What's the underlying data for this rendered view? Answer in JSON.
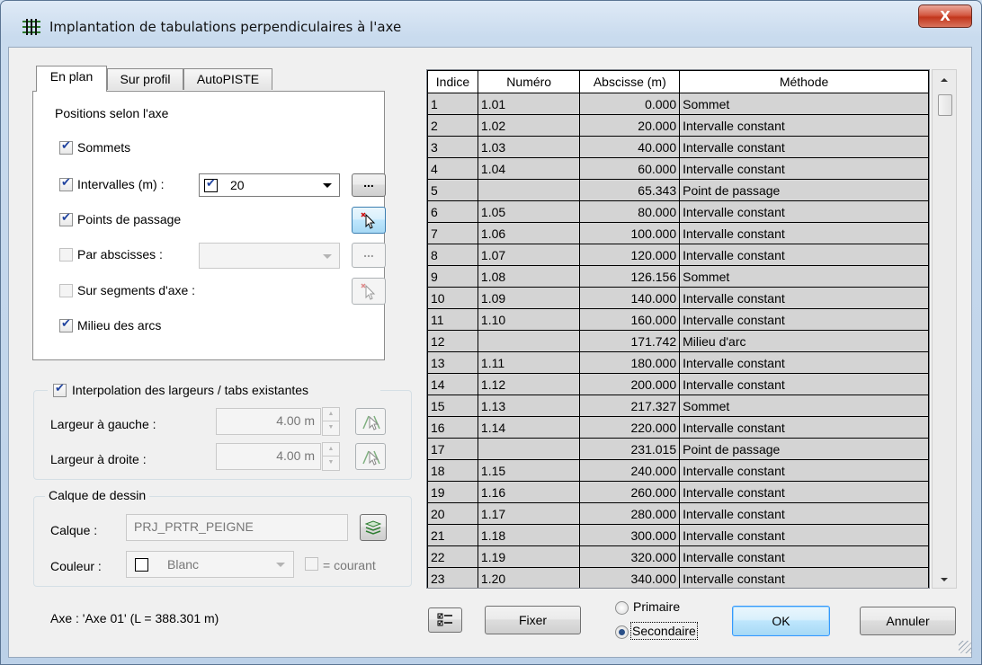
{
  "window": {
    "title": "Implantation de tabulations perpendiculaires à l'axe",
    "close_glyph": "X"
  },
  "tabs": [
    {
      "label": "En plan",
      "selected": true
    },
    {
      "label": "Sur profil",
      "selected": false
    },
    {
      "label": "AutoPISTE",
      "selected": false
    }
  ],
  "plan": {
    "group_title": "Positions selon l'axe",
    "sommets_label": "Sommets",
    "intervalles_label": "Intervalles (m) :",
    "intervalles_value": "20",
    "points_passage_label": "Points de passage",
    "par_abscisses_label": "Par abscisses :",
    "segments_label": "Sur segments d'axe :",
    "milieu_arcs_label": "Milieu des arcs",
    "ellipsis": "..."
  },
  "interpolation": {
    "label": "Interpolation des largeurs / tabs existantes",
    "gauche_label": "Largeur à gauche :",
    "gauche_value": "4.00 m",
    "droite_label": "Largeur à droite :",
    "droite_value": "4.00 m"
  },
  "calque": {
    "group_title": "Calque de dessin",
    "calque_label": "Calque :",
    "calque_value": "PRJ_PRTR_PEIGNE",
    "couleur_label": "Couleur :",
    "couleur_value": "Blanc",
    "courant_label": "= courant"
  },
  "axe_info": "Axe : 'Axe 01' (L = 388.301 m)",
  "table": {
    "headers": [
      "Indice",
      "Numéro",
      "Abscisse (m)",
      "Méthode"
    ],
    "rows": [
      [
        "1",
        "1.01",
        "0.000",
        "Sommet"
      ],
      [
        "2",
        "1.02",
        "20.000",
        "Intervalle constant"
      ],
      [
        "3",
        "1.03",
        "40.000",
        "Intervalle constant"
      ],
      [
        "4",
        "1.04",
        "60.000",
        "Intervalle constant"
      ],
      [
        "5",
        "",
        "65.343",
        "Point de passage"
      ],
      [
        "6",
        "1.05",
        "80.000",
        "Intervalle constant"
      ],
      [
        "7",
        "1.06",
        "100.000",
        "Intervalle constant"
      ],
      [
        "8",
        "1.07",
        "120.000",
        "Intervalle constant"
      ],
      [
        "9",
        "1.08",
        "126.156",
        "Sommet"
      ],
      [
        "10",
        "1.09",
        "140.000",
        "Intervalle constant"
      ],
      [
        "11",
        "1.10",
        "160.000",
        "Intervalle constant"
      ],
      [
        "12",
        "",
        "171.742",
        "Milieu d'arc"
      ],
      [
        "13",
        "1.11",
        "180.000",
        "Intervalle constant"
      ],
      [
        "14",
        "1.12",
        "200.000",
        "Intervalle constant"
      ],
      [
        "15",
        "1.13",
        "217.327",
        "Sommet"
      ],
      [
        "16",
        "1.14",
        "220.000",
        "Intervalle constant"
      ],
      [
        "17",
        "",
        "231.015",
        "Point de passage"
      ],
      [
        "18",
        "1.15",
        "240.000",
        "Intervalle constant"
      ],
      [
        "19",
        "1.16",
        "260.000",
        "Intervalle constant"
      ],
      [
        "20",
        "1.17",
        "280.000",
        "Intervalle constant"
      ],
      [
        "21",
        "1.18",
        "300.000",
        "Intervalle constant"
      ],
      [
        "22",
        "1.19",
        "320.000",
        "Intervalle constant"
      ],
      [
        "23",
        "1.20",
        "340.000",
        "Intervalle constant"
      ]
    ]
  },
  "bottom": {
    "fixer_label": "Fixer",
    "primaire_label": "Primaire",
    "secondaire_label": "Secondaire",
    "ok_label": "OK",
    "annuler_label": "Annuler"
  }
}
